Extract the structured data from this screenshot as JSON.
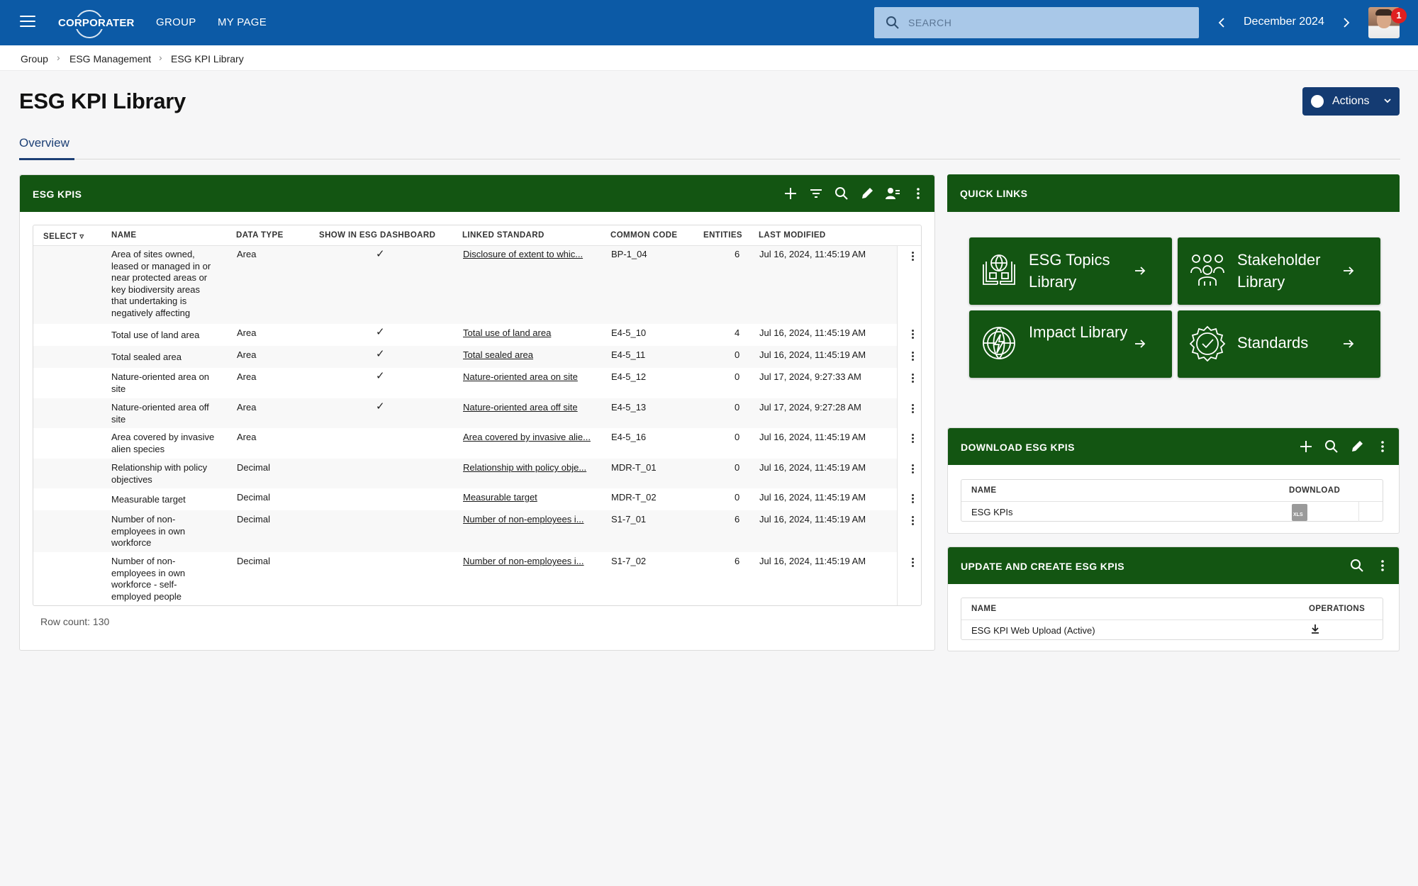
{
  "topbar": {
    "logo_text": "CORPORATER",
    "nav": [
      "GROUP",
      "MY PAGE"
    ],
    "search_placeholder": "SEARCH",
    "period": "December 2024",
    "notification_count": "1"
  },
  "breadcrumb": [
    "Group",
    "ESG Management",
    "ESG KPI Library"
  ],
  "page": {
    "title": "ESG KPI Library",
    "actions_label": "Actions",
    "tab": "Overview"
  },
  "kpis": {
    "title": "ESG KPIS",
    "columns": [
      "SELECT",
      "NAME",
      "DATA TYPE",
      "SHOW IN ESG DASHBOARD",
      "LINKED STANDARD",
      "COMMON CODE",
      "ENTITIES",
      "LAST MODIFIED"
    ],
    "rows": [
      {
        "name": "Area of sites owned, leased or managed in or near protected areas or key biodiversity areas that undertaking is negatively affecting",
        "type": "Area",
        "dashboard": true,
        "standard": "Disclosure of extent to whic...",
        "code": "BP-1_04",
        "entities": "6",
        "modified": "Jul 16, 2024, 11:45:19 AM"
      },
      {
        "name": "Total use of land area",
        "type": "Area",
        "dashboard": true,
        "standard": "Total use of land area",
        "code": "E4-5_10",
        "entities": "4",
        "modified": "Jul 16, 2024, 11:45:19 AM"
      },
      {
        "name": "Total sealed area",
        "type": "Area",
        "dashboard": true,
        "standard": "Total sealed area",
        "code": "E4-5_11",
        "entities": "0",
        "modified": "Jul 16, 2024, 11:45:19 AM"
      },
      {
        "name": "Nature-oriented area on site",
        "type": "Area",
        "dashboard": true,
        "standard": "Nature-oriented area on site",
        "code": "E4-5_12",
        "entities": "0",
        "modified": "Jul 17, 2024, 9:27:33 AM"
      },
      {
        "name": "Nature-oriented area off site",
        "type": "Area",
        "dashboard": true,
        "standard": "Nature-oriented area off site",
        "code": "E4-5_13",
        "entities": "0",
        "modified": "Jul 17, 2024, 9:27:28 AM"
      },
      {
        "name": "Area covered by invasive alien species",
        "type": "Area",
        "dashboard": false,
        "standard": "Area covered by invasive alie...",
        "code": "E4-5_16",
        "entities": "0",
        "modified": "Jul 16, 2024, 11:45:19 AM"
      },
      {
        "name": "Relationship with policy objectives",
        "type": "Decimal",
        "dashboard": false,
        "standard": "Relationship with policy obje...",
        "code": "MDR-T_01",
        "entities": "0",
        "modified": "Jul 16, 2024, 11:45:19 AM"
      },
      {
        "name": "Measurable target",
        "type": "Decimal",
        "dashboard": false,
        "standard": "Measurable target",
        "code": "MDR-T_02",
        "entities": "0",
        "modified": "Jul 16, 2024, 11:45:19 AM"
      },
      {
        "name": "Number of non-employees in own workforce",
        "type": "Decimal",
        "dashboard": false,
        "standard": "Number of non-employees i...",
        "code": "S1-7_01",
        "entities": "6",
        "modified": "Jul 16, 2024, 11:45:19 AM"
      },
      {
        "name": "Number of non-employees in own workforce - self-employed people",
        "type": "Decimal",
        "dashboard": false,
        "standard": "Number of non-employees i...",
        "code": "S1-7_02",
        "entities": "6",
        "modified": "Jul 16, 2024, 11:45:19 AM"
      }
    ],
    "row_count": "Row count: 130"
  },
  "quick_links": {
    "title": "QUICK LINKS",
    "tiles": [
      {
        "label": "ESG Topics Library",
        "icon": "book-globe-icon"
      },
      {
        "label": "Stakeholder Library",
        "icon": "people-group-icon"
      },
      {
        "label": "Impact Library",
        "icon": "globe-lightning-icon"
      },
      {
        "label": "Standards",
        "icon": "badge-check-icon"
      }
    ]
  },
  "download": {
    "title": "DOWNLOAD ESG KPIS",
    "columns": [
      "NAME",
      "DOWNLOAD"
    ],
    "rows": [
      {
        "name": "ESG KPIs",
        "file_icon": "xls-file-icon",
        "file_label": "XLS"
      }
    ]
  },
  "update": {
    "title": "UPDATE AND CREATE ESG KPIS",
    "columns": [
      "NAME",
      "OPERATIONS"
    ],
    "rows": [
      {
        "name": "ESG KPI Web Upload (Active)",
        "op_icon": "download-icon"
      }
    ]
  },
  "colors": {
    "topbar": "#0c5aa6",
    "panel_header": "#135512",
    "actions": "#143b72",
    "tab": "#1c3f75"
  }
}
